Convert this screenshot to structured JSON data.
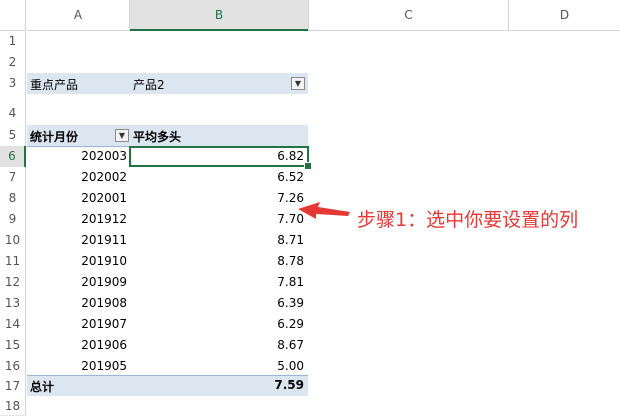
{
  "columns": [
    "A",
    "B",
    "C",
    "D"
  ],
  "rows": [
    "1",
    "2",
    "3",
    "4",
    "5",
    "6",
    "7",
    "8",
    "9",
    "10",
    "11",
    "12",
    "13",
    "14",
    "15",
    "16",
    "17",
    "18"
  ],
  "filter_row": {
    "label": "重点产品",
    "value": "产品2"
  },
  "pivot": {
    "row_header": "统计月份",
    "value_header": "平均多头",
    "data": [
      {
        "month": "202003",
        "value": "6.82"
      },
      {
        "month": "202002",
        "value": "6.52"
      },
      {
        "month": "202001",
        "value": "7.26"
      },
      {
        "month": "201912",
        "value": "7.70"
      },
      {
        "month": "201911",
        "value": "8.71"
      },
      {
        "month": "201910",
        "value": "8.78"
      },
      {
        "month": "201909",
        "value": "7.81"
      },
      {
        "month": "201908",
        "value": "6.39"
      },
      {
        "month": "201907",
        "value": "6.29"
      },
      {
        "month": "201906",
        "value": "8.67"
      },
      {
        "month": "201905",
        "value": "5.00"
      }
    ],
    "total_label": "总计",
    "total_value": "7.59"
  },
  "annotation": "步骤1：选中你要设置的列",
  "colors": {
    "accent": "#217346",
    "pivot_band": "#dce6f1",
    "annotation": "#e53935"
  },
  "icons": {
    "filter": "filter-dropdown-icon",
    "arrow": "red-arrow-icon"
  }
}
